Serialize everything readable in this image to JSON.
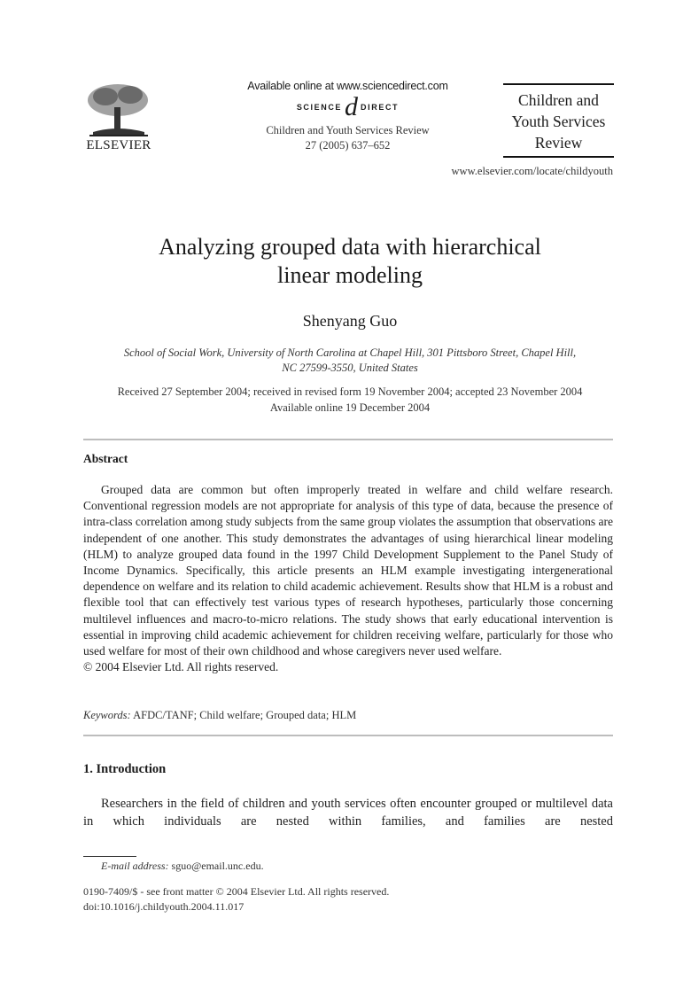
{
  "header": {
    "publisher": "ELSEVIER",
    "available_online": "Available online at www.sciencedirect.com",
    "sciencedirect_left": "SCIENCE",
    "sciencedirect_at": "d",
    "sciencedirect_right": "DIRECT",
    "journal_name": "Children and Youth Services Review",
    "journal_citation": "27 (2005) 637–652",
    "journal_box_lines": [
      "Children and",
      "Youth Services",
      "Review"
    ],
    "journal_url": "www.elsevier.com/locate/childyouth"
  },
  "article": {
    "title_line1": "Analyzing grouped data with hierarchical",
    "title_line2": "linear modeling",
    "author": "Shenyang Guo",
    "affiliation_line1": "School of Social Work, University of North Carolina at Chapel Hill, 301 Pittsboro Street, Chapel Hill,",
    "affiliation_line2": "NC 27599-3550, United States",
    "dates_line1": "Received 27 September 2004; received in revised form 19 November 2004; accepted 23 November 2004",
    "dates_line2": "Available online 19 December 2004"
  },
  "abstract": {
    "heading": "Abstract",
    "text": "Grouped data are common but often improperly treated in welfare and child welfare research. Conventional regression models are not appropriate for analysis of this type of data, because the presence of intra-class correlation among study subjects from the same group violates the assumption that observations are independent of one another. This study demonstrates the advantages of using hierarchical linear modeling (HLM) to analyze grouped data found in the 1997 Child Development Supplement to the Panel Study of Income Dynamics. Specifically, this article presents an HLM example investigating intergenerational dependence on welfare and its relation to child academic achievement. Results show that HLM is a robust and flexible tool that can effectively test various types of research hypotheses, particularly those concerning multilevel influences and macro-to-micro relations. The study shows that early educational intervention is essential in improving child academic achievement for children receiving welfare, particularly for those who used welfare for most of their own childhood and whose caregivers never used welfare.",
    "copyright": "© 2004 Elsevier Ltd. All rights reserved."
  },
  "keywords": {
    "label": "Keywords:",
    "value": "AFDC/TANF; Child welfare; Grouped data; HLM"
  },
  "introduction": {
    "heading": "1. Introduction",
    "text": "Researchers in the field of children and youth services often encounter grouped or multilevel data in which individuals are nested within families, and families are nested"
  },
  "footnote": {
    "label": "E-mail address:",
    "value": "sguo@email.unc.edu."
  },
  "front_matter": {
    "issn_line": "0190-7409/$ - see front matter © 2004 Elsevier Ltd. All rights reserved.",
    "doi": "doi:10.1016/j.childyouth.2004.11.017"
  }
}
